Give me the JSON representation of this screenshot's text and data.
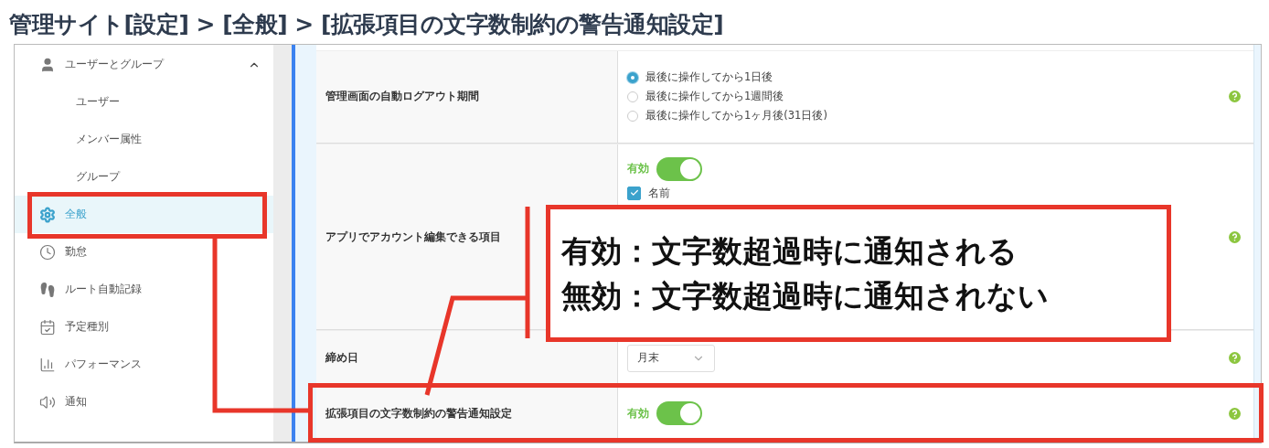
{
  "title": "管理サイト[設定] > [全般] > [拡張項目の文字数制約の警告通知設定]",
  "sidebar": {
    "items": [
      {
        "label": "ユーザーとグループ",
        "selected": false,
        "expanded": true,
        "children": [
          {
            "label": "ユーザー",
            "selected": false
          },
          {
            "label": "メンバー属性",
            "selected": false
          },
          {
            "label": "グループ",
            "selected": false
          }
        ]
      },
      {
        "label": "全般",
        "selected": true
      },
      {
        "label": "勤怠",
        "selected": false
      },
      {
        "label": "ルート自動記録",
        "selected": false
      },
      {
        "label": "予定種別",
        "selected": false
      },
      {
        "label": "パフォーマンス",
        "selected": false
      },
      {
        "label": "通知",
        "selected": false
      }
    ]
  },
  "settings": [
    {
      "label": "管理画面の自動ログアウト期間",
      "kind": "radio",
      "options": [
        {
          "label": "最後に操作してから1日後",
          "selected": true
        },
        {
          "label": "最後に操作してから1週間後",
          "selected": false
        },
        {
          "label": "最後に操作してから1ヶ月後(31日後)",
          "selected": false
        }
      ]
    },
    {
      "label": "アプリでアカウント編集できる項目",
      "kind": "toggle",
      "toggle": {
        "label": "有効",
        "on": true
      },
      "checks": [
        {
          "label": "名前",
          "checked": true
        }
      ]
    },
    {
      "label": "締め日",
      "kind": "select",
      "value": "月末"
    },
    {
      "label": "拡張項目の文字数制約の警告通知設定",
      "kind": "toggle",
      "toggle": {
        "label": "有効",
        "on": true
      }
    }
  ],
  "annotation": {
    "lines": [
      "有効：文字数超過時に通知される",
      "無効：文字数超過時に通知されない"
    ]
  }
}
